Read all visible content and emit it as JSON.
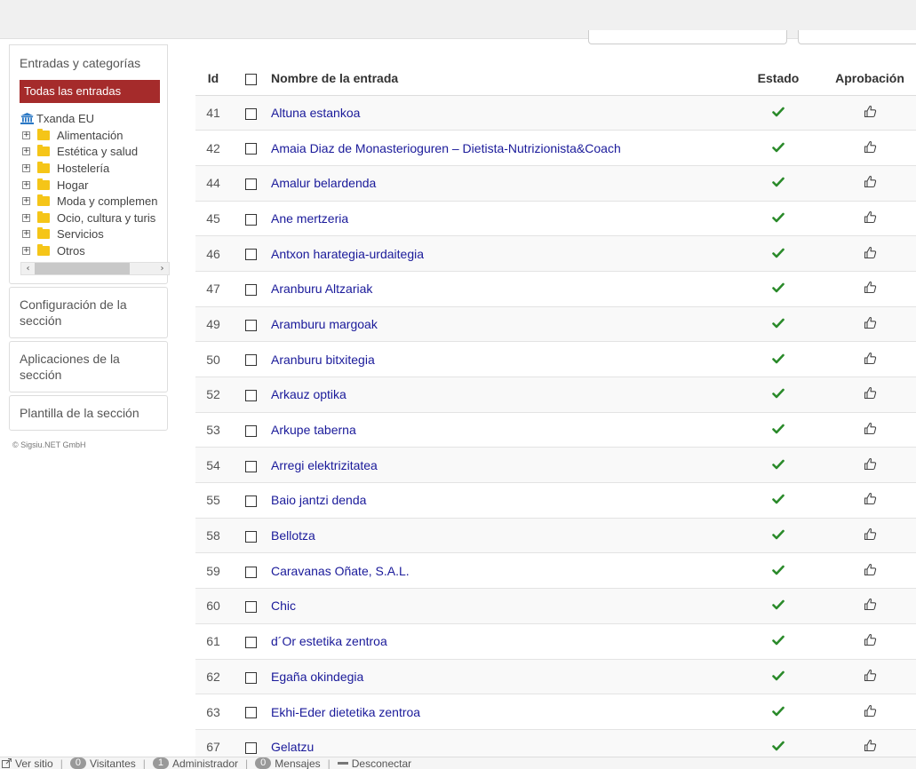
{
  "sidebar": {
    "entries_title": "Entradas y categorías",
    "all_entries": "Todas las entradas",
    "tree_root": "Txanda EU",
    "tree_items": [
      "Alimentación",
      "Estética y salud",
      "Hostelería",
      "Hogar",
      "Moda y complemen",
      "Ocio, cultura y turis",
      "Servicios",
      "Otros"
    ],
    "config": "Configuración de la sección",
    "apps": "Aplicaciones de la sección",
    "template": "Plantilla de la sección",
    "copyright": "© Sigsiu.NET GmbH"
  },
  "table": {
    "headers": {
      "id": "Id",
      "name": "Nombre de la entrada",
      "state": "Estado",
      "approval": "Aprobación"
    },
    "rows": [
      {
        "id": "41",
        "name": "Altuna estankoa"
      },
      {
        "id": "42",
        "name": "Amaia Diaz de Monasterioguren – Dietista-Nutrizionista&Coach"
      },
      {
        "id": "44",
        "name": "Amalur belardenda"
      },
      {
        "id": "45",
        "name": "Ane mertzeria"
      },
      {
        "id": "46",
        "name": "Antxon harategia-urdaitegia"
      },
      {
        "id": "47",
        "name": "Aranburu Altzariak"
      },
      {
        "id": "49",
        "name": "Aramburu margoak"
      },
      {
        "id": "50",
        "name": "Aranburu bitxitegia"
      },
      {
        "id": "52",
        "name": "Arkauz optika"
      },
      {
        "id": "53",
        "name": "Arkupe taberna"
      },
      {
        "id": "54",
        "name": "Arregi elektrizitatea"
      },
      {
        "id": "55",
        "name": "Baio jantzi denda"
      },
      {
        "id": "58",
        "name": "Bellotza"
      },
      {
        "id": "59",
        "name": "Caravanas Oñate, S.A.L."
      },
      {
        "id": "60",
        "name": "Chic"
      },
      {
        "id": "61",
        "name": "d´Or estetika zentroa"
      },
      {
        "id": "62",
        "name": "Egaña okindegia"
      },
      {
        "id": "63",
        "name": "Ekhi-Eder dietetika zentroa"
      },
      {
        "id": "67",
        "name": "Gelatzu"
      }
    ]
  },
  "statusbar": {
    "view_site": "Ver sitio",
    "visitors_count": "0",
    "visitors": "Visitantes",
    "admin_count": "1",
    "admin": "Administrador",
    "messages_count": "0",
    "messages": "Mensajes",
    "logout": "Desconectar"
  },
  "icons": {
    "state": "check-icon",
    "approval": "thumbs-up-icon",
    "root": "bank-icon",
    "folder": "folder-icon"
  },
  "colors": {
    "accent": "#a52b2b",
    "link": "#1a1a9a",
    "check": "#2a8a2a"
  }
}
